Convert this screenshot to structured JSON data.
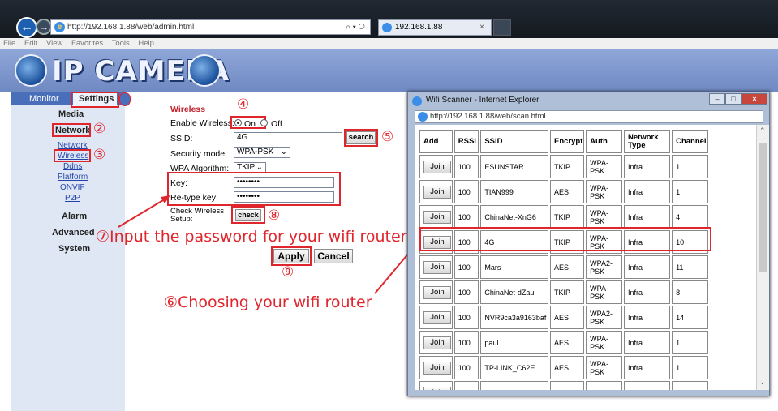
{
  "browser": {
    "url": "http://192.168.1.88/web/admin.html",
    "tab_title": "192.168.1.88",
    "search_glyph": "⌕ ▾ ↻",
    "menu": [
      "File",
      "Edit",
      "View",
      "Favorites",
      "Tools",
      "Help"
    ]
  },
  "banner": {
    "logo_text": "IP CAMERA"
  },
  "nav": {
    "monitor": "Monitor",
    "settings": "Settings",
    "media": "Media",
    "network": "Network",
    "links": [
      "Network",
      "Wireless",
      "Ddns",
      "Platform",
      "ONVIF",
      "P2P"
    ],
    "alarm": "Alarm",
    "advanced": "Advanced",
    "system": "System"
  },
  "form": {
    "section_title": "Wireless",
    "enable_label": "Enable Wireless:",
    "on_label": "On",
    "off_label": "Off",
    "ssid_label": "SSID:",
    "ssid_value": "4G",
    "search_label": "search",
    "security_label": "Security mode:",
    "security_value": "WPA-PSK",
    "algo_label": "WPA Algorithm:",
    "algo_value": "TKIP",
    "key_label": "Key:",
    "key_value": "••••••••",
    "retype_label": "Re-type key:",
    "retype_value": "••••••••",
    "check_label": "Check Wireless Setup:",
    "check_button": "check",
    "apply": "Apply",
    "cancel": "Cancel"
  },
  "annotations": {
    "n2": "②",
    "n3": "③",
    "n4": "④",
    "n5": "⑤",
    "n6": "⑥",
    "n7": "⑦",
    "n8": "⑧",
    "n9": "⑨",
    "input_pw": "⑦Input the password for your wifi router",
    "choose": "⑥Choosing your wifi router"
  },
  "popup": {
    "title": "Wifi Scanner - Internet Explorer",
    "url": "http://192.168.1.88/web/scan.html",
    "columns": [
      "Add",
      "RSSI",
      "SSID",
      "Encrypt",
      "Auth",
      "Network Type",
      "Channel"
    ],
    "join_label": "Join",
    "rows": [
      [
        "100",
        "ESUNSTAR",
        "TKIP",
        "WPA-PSK",
        "Infra",
        "1"
      ],
      [
        "100",
        "TIAN999",
        "AES",
        "WPA-PSK",
        "Infra",
        "1"
      ],
      [
        "100",
        "ChinaNet-XnG6",
        "TKIP",
        "WPA-PSK",
        "Infra",
        "4"
      ],
      [
        "100",
        "4G",
        "TKIP",
        "WPA-PSK",
        "Infra",
        "10"
      ],
      [
        "100",
        "Mars",
        "AES",
        "WPA2-PSK",
        "Infra",
        "11"
      ],
      [
        "100",
        "ChinaNet-dZau",
        "TKIP",
        "WPA-PSK",
        "Infra",
        "8"
      ],
      [
        "100",
        "NVR9ca3a9163baf",
        "AES",
        "WPA2-PSK",
        "Infra",
        "14"
      ],
      [
        "100",
        "paul",
        "AES",
        "WPA-PSK",
        "Infra",
        "1"
      ],
      [
        "100",
        "TP-LINK_C62E",
        "AES",
        "WPA-PSK",
        "Infra",
        "1"
      ],
      [
        "",
        "",
        "",
        "WPA-",
        "",
        ""
      ]
    ]
  }
}
